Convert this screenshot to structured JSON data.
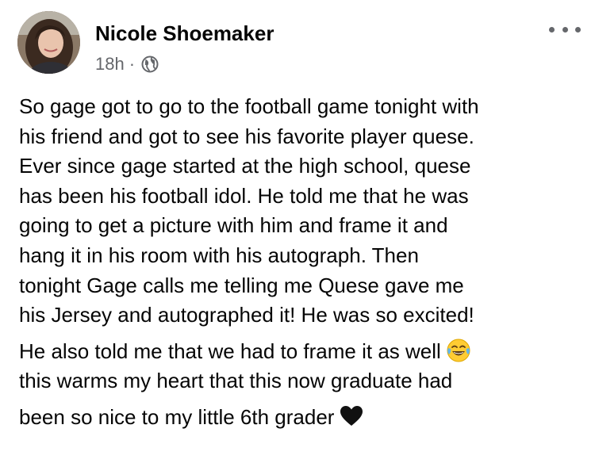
{
  "post": {
    "author": "Nicole Shoemaker",
    "time": "18h",
    "separator": "·",
    "privacy_icon": "globe-icon",
    "menu_icon": "more-options-icon",
    "lines": [
      "So gage got to go to the football game tonight with",
      "his friend and got to see his favorite player quese.",
      "Ever since gage started at the high school, quese",
      "has been his football idol.  He told me that he was",
      "going to get a picture with him and frame it and",
      "hang it in his room with his autograph.  Then",
      "tonight Gage calls me telling me Quese gave me",
      "his Jersey and autographed it! He was so excited!",
      "He also told me that we had to frame it as well",
      "this warms my heart that this now graduate had",
      "been so nice to my little 6th grader"
    ],
    "emojis": {
      "laughing": "tears-of-joy-emoji",
      "heart": "black-heart-emoji"
    }
  }
}
